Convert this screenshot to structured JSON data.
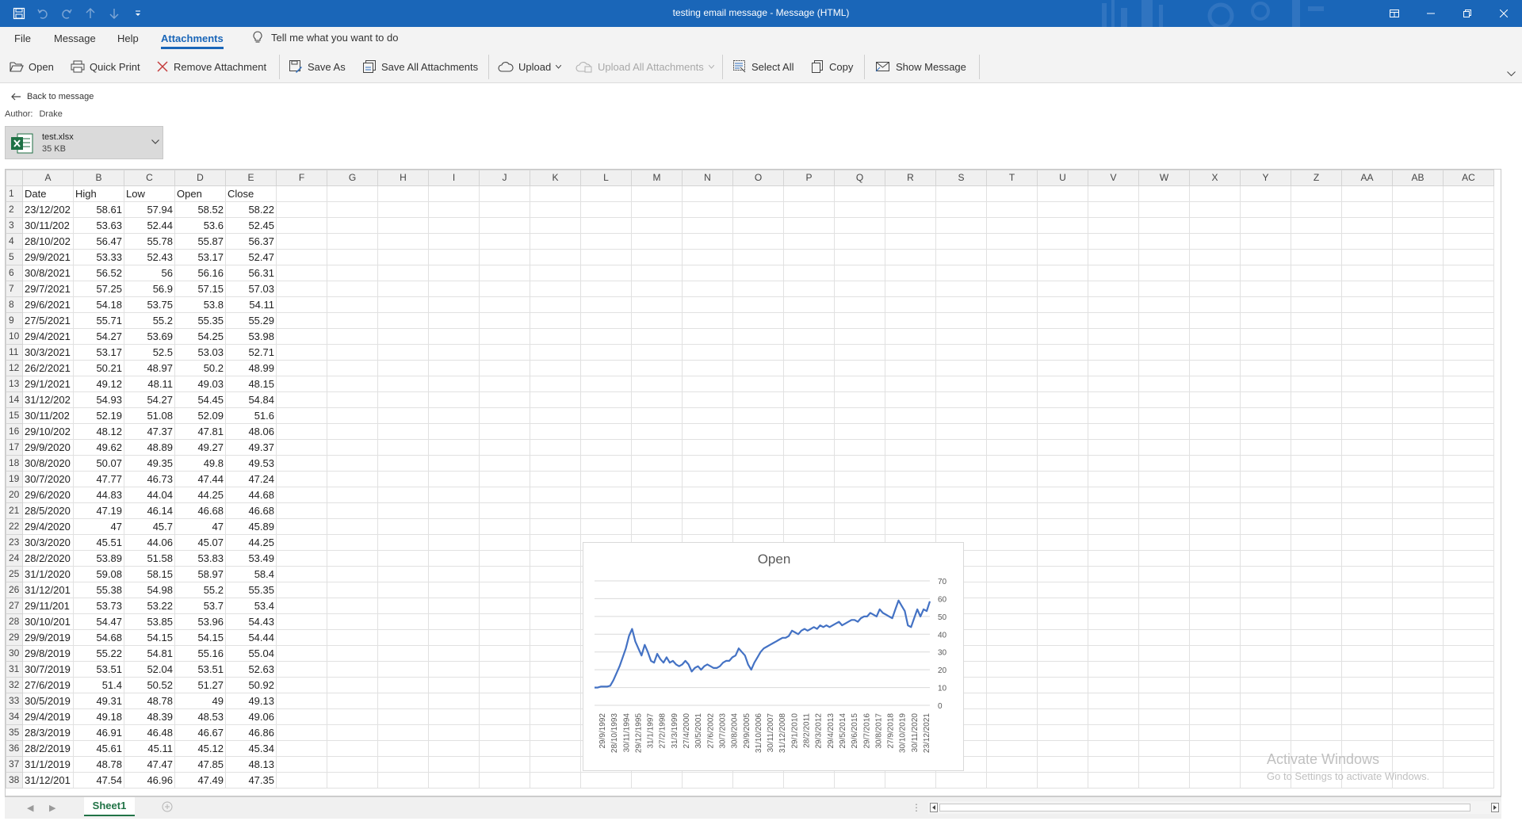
{
  "window": {
    "title": "testing email message  -  Message (HTML)"
  },
  "tabs": {
    "items": [
      "File",
      "Message",
      "Help",
      "Attachments"
    ],
    "active": "Attachments",
    "tellme": "Tell me what you want to do"
  },
  "ribbon": {
    "open": "Open",
    "quick_print": "Quick Print",
    "remove_attachment": "Remove Attachment",
    "save_as": "Save As",
    "save_all": "Save All Attachments",
    "upload": "Upload",
    "upload_all": "Upload All Attachments",
    "select_all": "Select All",
    "copy": "Copy",
    "show_message": "Show Message"
  },
  "back_label": "Back to message",
  "author": {
    "label": "Author:",
    "name": "Drake"
  },
  "attachment": {
    "name": "test.xlsx",
    "size": "35 KB"
  },
  "sheet": {
    "columns": [
      "A",
      "B",
      "C",
      "D",
      "E",
      "F",
      "G",
      "H",
      "I",
      "J",
      "K",
      "L",
      "M",
      "N",
      "O",
      "P",
      "Q",
      "R",
      "S",
      "T",
      "U",
      "V",
      "W",
      "X",
      "Y",
      "Z",
      "AA",
      "AB",
      "AC"
    ],
    "header_row": [
      "Date",
      "High",
      "Low",
      "Open",
      "Close"
    ],
    "rows": [
      [
        "23/12/202",
        "58.61",
        "57.94",
        "58.52",
        "58.22"
      ],
      [
        "30/11/202",
        "53.63",
        "52.44",
        "53.6",
        "52.45"
      ],
      [
        "28/10/202",
        "56.47",
        "55.78",
        "55.87",
        "56.37"
      ],
      [
        "29/9/2021",
        "53.33",
        "52.43",
        "53.17",
        "52.47"
      ],
      [
        "30/8/2021",
        "56.52",
        "56",
        "56.16",
        "56.31"
      ],
      [
        "29/7/2021",
        "57.25",
        "56.9",
        "57.15",
        "57.03"
      ],
      [
        "29/6/2021",
        "54.18",
        "53.75",
        "53.8",
        "54.11"
      ],
      [
        "27/5/2021",
        "55.71",
        "55.2",
        "55.35",
        "55.29"
      ],
      [
        "29/4/2021",
        "54.27",
        "53.69",
        "54.25",
        "53.98"
      ],
      [
        "30/3/2021",
        "53.17",
        "52.5",
        "53.03",
        "52.71"
      ],
      [
        "26/2/2021",
        "50.21",
        "48.97",
        "50.2",
        "48.99"
      ],
      [
        "29/1/2021",
        "49.12",
        "48.11",
        "49.03",
        "48.15"
      ],
      [
        "31/12/202",
        "54.93",
        "54.27",
        "54.45",
        "54.84"
      ],
      [
        "30/11/202",
        "52.19",
        "51.08",
        "52.09",
        "51.6"
      ],
      [
        "29/10/202",
        "48.12",
        "47.37",
        "47.81",
        "48.06"
      ],
      [
        "29/9/2020",
        "49.62",
        "48.89",
        "49.27",
        "49.37"
      ],
      [
        "30/8/2020",
        "50.07",
        "49.35",
        "49.8",
        "49.53"
      ],
      [
        "30/7/2020",
        "47.77",
        "46.73",
        "47.44",
        "47.24"
      ],
      [
        "29/6/2020",
        "44.83",
        "44.04",
        "44.25",
        "44.68"
      ],
      [
        "28/5/2020",
        "47.19",
        "46.14",
        "46.68",
        "46.68"
      ],
      [
        "29/4/2020",
        "47",
        "45.7",
        "47",
        "45.89"
      ],
      [
        "30/3/2020",
        "45.51",
        "44.06",
        "45.07",
        "44.25"
      ],
      [
        "28/2/2020",
        "53.89",
        "51.58",
        "53.83",
        "53.49"
      ],
      [
        "31/1/2020",
        "59.08",
        "58.15",
        "58.97",
        "58.4"
      ],
      [
        "31/12/201",
        "55.38",
        "54.98",
        "55.2",
        "55.35"
      ],
      [
        "29/11/201",
        "53.73",
        "53.22",
        "53.7",
        "53.4"
      ],
      [
        "30/10/201",
        "54.47",
        "53.85",
        "53.96",
        "54.43"
      ],
      [
        "29/9/2019",
        "54.68",
        "54.15",
        "54.15",
        "54.44"
      ],
      [
        "29/8/2019",
        "55.22",
        "54.81",
        "55.16",
        "55.04"
      ],
      [
        "30/7/2019",
        "53.51",
        "52.04",
        "53.51",
        "52.63"
      ],
      [
        "27/6/2019",
        "51.4",
        "50.52",
        "51.27",
        "50.92"
      ],
      [
        "30/5/2019",
        "49.31",
        "48.78",
        "49",
        "49.13"
      ],
      [
        "29/4/2019",
        "49.18",
        "48.39",
        "48.53",
        "49.06"
      ],
      [
        "28/3/2019",
        "46.91",
        "46.48",
        "46.67",
        "46.86"
      ],
      [
        "28/2/2019",
        "45.61",
        "45.11",
        "45.12",
        "45.34"
      ],
      [
        "31/1/2019",
        "48.78",
        "47.47",
        "47.85",
        "48.13"
      ],
      [
        "31/12/201",
        "47.54",
        "46.96",
        "47.49",
        "47.35"
      ]
    ],
    "tab_name": "Sheet1"
  },
  "chart_data": {
    "type": "line",
    "title": "Open",
    "xlabel": "",
    "ylabel": "",
    "ylim": [
      0,
      70
    ],
    "y_ticks": [
      0,
      10,
      20,
      30,
      40,
      50,
      60,
      70
    ],
    "y_axis_position": "right",
    "grid": true,
    "legend": "none",
    "color": "#4472c4",
    "x_tick_labels": [
      "29/9/1992",
      "28/10/1993",
      "30/11/1994",
      "29/12/1995",
      "31/1/1997",
      "27/2/1998",
      "31/3/1999",
      "27/4/2000",
      "30/5/2001",
      "27/6/2002",
      "30/7/2003",
      "30/8/2004",
      "29/9/2005",
      "31/10/2006",
      "30/11/2007",
      "31/12/2008",
      "29/1/2010",
      "28/2/2011",
      "29/3/2012",
      "29/4/2013",
      "29/5/2014",
      "29/6/2015",
      "29/7/2016",
      "30/8/2017",
      "27/9/2018",
      "30/10/2019",
      "30/11/2020",
      "23/12/2021"
    ],
    "series": [
      {
        "x": [
          "Sep 1992",
          "Mar 1993",
          "Sep 1993",
          "Mar 1994",
          "Sep 1994",
          "Mar 1995",
          "Sep 1995",
          "Mar 1996",
          "Sep 1996",
          "Mar 1997",
          "Sep 1997",
          "Jan 1998",
          "Apr 1998",
          "Jul 1998",
          "Oct 1998",
          "Jan 1999",
          "Apr 1999",
          "Jul 1999",
          "Oct 1999",
          "Jan 2000",
          "Apr 2000",
          "Jul 2000",
          "Oct 2000",
          "Jan 2001",
          "Apr 2001",
          "Jul 2001",
          "Oct 2001",
          "Jan 2002",
          "Apr 2002",
          "Jul 2002",
          "Oct 2002",
          "Jan 2003",
          "Apr 2003",
          "Jul 2003",
          "Oct 2003",
          "Jan 2004",
          "Apr 2004",
          "Jul 2004",
          "Oct 2004",
          "Jan 2005",
          "Apr 2005",
          "Jul 2005",
          "Oct 2005",
          "Jan 2006",
          "Apr 2006",
          "Jul 2006",
          "Oct 2006",
          "Jan 2007",
          "Apr 2007",
          "Jul 2007",
          "Oct 2007",
          "Jan 2008",
          "Apr 2008",
          "Jul 2008",
          "Oct 2008",
          "Jan 2009",
          "Apr 2009",
          "Jul 2009",
          "Oct 2009",
          "Jan 2010",
          "Apr 2010",
          "Jul 2010",
          "Oct 2010",
          "Jan 2011",
          "Apr 2011",
          "Jul 2011",
          "Oct 2011",
          "Jan 2012",
          "Apr 2012",
          "Jul 2012",
          "Oct 2012",
          "Jan 2013",
          "Apr 2013",
          "Jul 2013",
          "Oct 2013",
          "Jan 2014",
          "Apr 2014",
          "Jul 2014",
          "Oct 2014",
          "Jan 2015",
          "Apr 2015",
          "Jul 2015",
          "Oct 2015",
          "Jan 2016",
          "Apr 2016",
          "Jul 2016",
          "Oct 2016",
          "Jan 2017",
          "Apr 2017",
          "Jul 2017",
          "Oct 2017",
          "Jan 2018",
          "Apr 2018",
          "Jul 2018",
          "Oct 2018",
          "Jan 2019",
          "Apr 2019",
          "Jul 2019",
          "Oct 2019",
          "Jan 2020",
          "Mar 2020",
          "Jun 2020",
          "Sep 2020",
          "Dec 2020",
          "Mar 2021",
          "Jun 2021",
          "Sep 2021",
          "Dec 2021"
        ],
        "values": [
          10,
          10,
          10.5,
          10.5,
          10.5,
          11,
          14,
          18,
          22,
          27,
          32,
          39,
          43,
          36,
          32,
          28,
          34,
          30,
          25,
          24,
          29,
          26,
          24,
          27,
          24,
          25,
          23,
          22,
          23,
          25,
          23,
          19,
          21,
          22,
          20,
          22,
          23,
          22,
          21,
          21,
          22,
          24,
          25,
          25,
          27,
          28,
          32,
          30,
          28,
          23,
          20,
          24,
          27,
          30,
          32,
          33,
          34,
          35,
          36,
          37,
          38,
          38,
          39,
          42,
          41,
          40,
          42,
          43,
          42,
          43,
          44,
          43,
          45,
          44,
          45,
          44,
          45,
          46,
          47,
          45,
          46,
          47,
          48,
          48,
          47,
          49,
          50,
          50,
          52,
          51,
          50,
          54,
          52,
          51,
          50,
          49,
          54,
          59,
          56,
          53,
          45,
          44,
          49,
          54,
          50,
          54,
          53,
          58.5
        ]
      }
    ]
  },
  "watermark": {
    "line1": "Activate Windows",
    "line2": "Go to Settings to activate Windows."
  }
}
